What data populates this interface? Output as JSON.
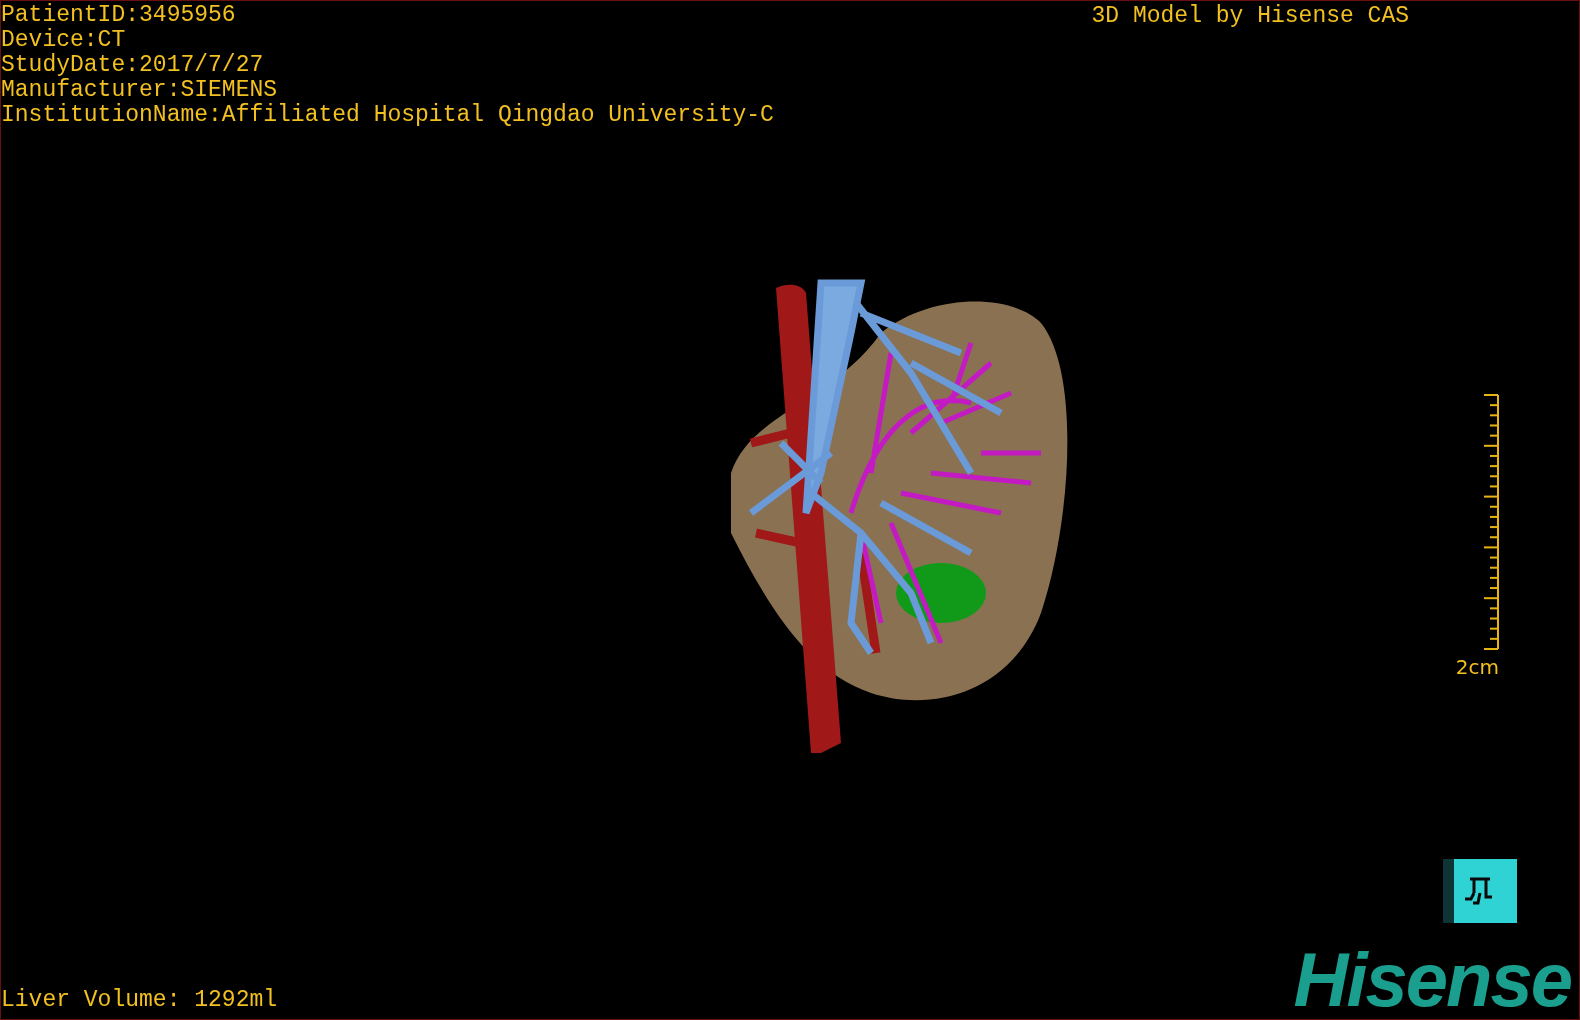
{
  "header": {
    "info_lines": [
      "PatientID:3495956",
      "Device:CT",
      "StudyDate:2017/7/27",
      "Manufacturer:SIEMENS",
      "InstitutionName:Affiliated Hospital Qingdao University-C"
    ],
    "credit": "3D Model by Hisense CAS"
  },
  "scale_bar": {
    "label": "2cm"
  },
  "footer": {
    "volume": "Liver Volume: 1292ml",
    "logo": "Hisense"
  }
}
